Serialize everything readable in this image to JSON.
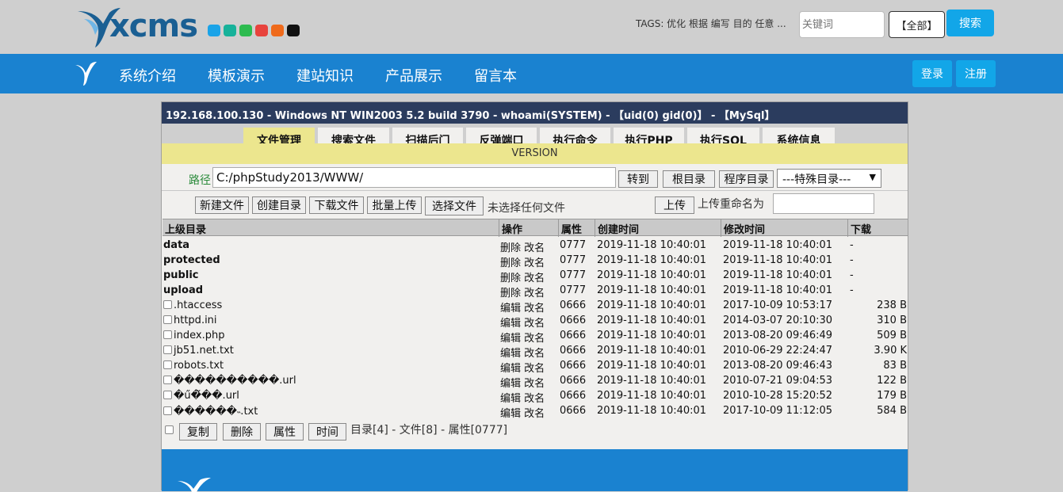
{
  "site": {
    "logo_text": "xcms",
    "swatch_colors": [
      "#1aa3e8",
      "#17b29a",
      "#2dbb4f",
      "#e8433d",
      "#ef6a1b",
      "#111111"
    ],
    "tags_text": "TAGS: 优化 根据 编写 目的 任意 ...",
    "search_placeholder": "关键词",
    "scope_label": "【全部】",
    "search_label": "搜索",
    "nav": [
      "系统介绍",
      "模板演示",
      "建站知识",
      "产品展示",
      "留言本"
    ],
    "login_label": "登录",
    "register_label": "注册"
  },
  "shell": {
    "header": "192.168.100.130 - Windows NT WIN2003 5.2 build 3790 - whoami(SYSTEM) - 【uid(0) gid(0)】 - 【MySql】",
    "tabs": [
      "文件管理",
      "搜索文件",
      "扫描后门",
      "反弹端口",
      "执行命令",
      "执行PHP",
      "执行SQL",
      "系统信息"
    ],
    "version": "VERSION",
    "path_label": "路径",
    "path_value": "C:/phpStudy2013/WWW/",
    "goto_label": "转到",
    "root_label": "根目录",
    "progdir_label": "程序目录",
    "special_dir": "---特殊目录---",
    "newfile_label": "新建文件",
    "mkdir_label": "创建目录",
    "download_label": "下载文件",
    "batch_upload_label": "批量上传",
    "choose_file_label": "选择文件",
    "no_file_label": "未选择任何文件",
    "upload_label": "上传",
    "rename_label": "上传重命名为",
    "columns": {
      "name": "上级目录",
      "ops": "操作",
      "attr": "属性",
      "created": "创建时间",
      "modified": "修改时间",
      "download": "下载"
    },
    "dirs": [
      {
        "name": "data",
        "ops": "删除 改名",
        "attr": "0777",
        "created": "2019-11-18 10:40:01",
        "modified": "2019-11-18 10:40:01",
        "download": "-"
      },
      {
        "name": "protected",
        "ops": "删除 改名",
        "attr": "0777",
        "created": "2019-11-18 10:40:01",
        "modified": "2019-11-18 10:40:01",
        "download": "-"
      },
      {
        "name": "public",
        "ops": "删除 改名",
        "attr": "0777",
        "created": "2019-11-18 10:40:01",
        "modified": "2019-11-18 10:40:01",
        "download": "-"
      },
      {
        "name": "upload",
        "ops": "删除 改名",
        "attr": "0777",
        "created": "2019-11-18 10:40:01",
        "modified": "2019-11-18 10:40:01",
        "download": "-"
      }
    ],
    "files": [
      {
        "name": ".htaccess",
        "ops": "编辑 改名",
        "attr": "0666",
        "created": "2019-11-18 10:40:01",
        "modified": "2017-10-09 10:53:17",
        "size": "238 B"
      },
      {
        "name": "httpd.ini",
        "ops": "编辑 改名",
        "attr": "0666",
        "created": "2019-11-18 10:40:01",
        "modified": "2014-03-07 20:10:30",
        "size": "310 B"
      },
      {
        "name": "index.php",
        "ops": "编辑 改名",
        "attr": "0666",
        "created": "2019-11-18 10:40:01",
        "modified": "2013-08-20 09:46:49",
        "size": "509 B"
      },
      {
        "name": "jb51.net.txt",
        "ops": "编辑 改名",
        "attr": "0666",
        "created": "2019-11-18 10:40:01",
        "modified": "2010-06-29 22:24:47",
        "size": "3.90 K"
      },
      {
        "name": "robots.txt",
        "ops": "编辑 改名",
        "attr": "0666",
        "created": "2019-11-18 10:40:01",
        "modified": "2013-08-20 09:46:43",
        "size": "83 B"
      },
      {
        "name": "����������.url",
        "ops": "编辑 改名",
        "attr": "0666",
        "created": "2019-11-18 10:40:01",
        "modified": "2010-07-21 09:04:53",
        "size": "122 B"
      },
      {
        "name": "�ű�̌��.url",
        "ops": "编辑 改名",
        "attr": "0666",
        "created": "2019-11-18 10:40:01",
        "modified": "2010-10-28 15:20:52",
        "size": "179 B"
      },
      {
        "name": "������˵.txt",
        "ops": "编辑 改名",
        "attr": "0666",
        "created": "2019-11-18 10:40:01",
        "modified": "2017-10-09 11:12:05",
        "size": "584 B"
      }
    ],
    "copy_label": "复制",
    "delete_label": "删除",
    "attr_label": "属性",
    "time_label": "时间",
    "summary": "目录[4] - 文件[8] - 属性[0777]"
  }
}
